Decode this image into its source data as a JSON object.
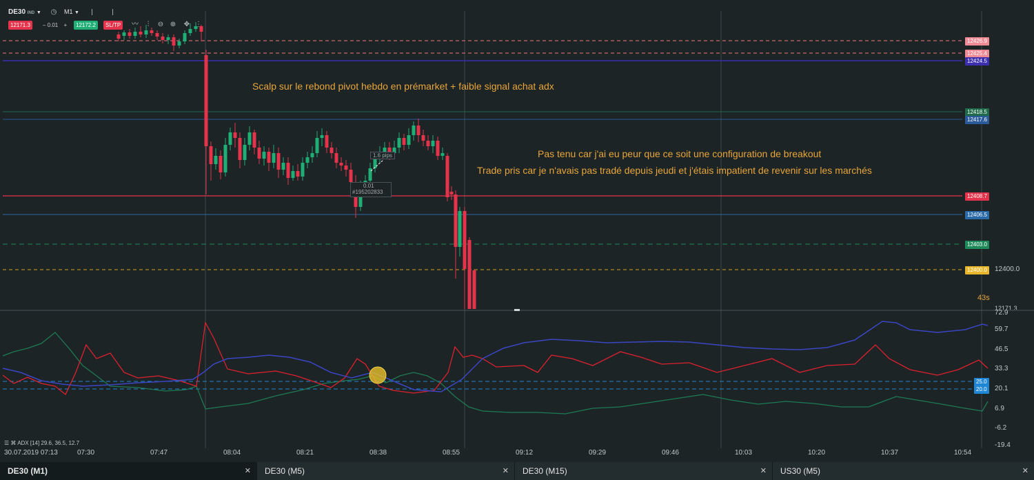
{
  "toolbar": {
    "symbol": "DE30",
    "symbol_sub": "IND",
    "timeframe": "M1",
    "sell_price": "12171.3",
    "quantity": "0.01",
    "buy_price": "12172.2",
    "sltp_label": "SL/TP"
  },
  "price_tags": {
    "p1": "12426.9",
    "p2": "12425.4",
    "p3": "12424.5",
    "p4": "12418.5",
    "p5": "12417.6",
    "p6": "12408.7",
    "p7": "12406.5",
    "p8": "12403.0",
    "p9": "12400.0",
    "axis_price": "12400.0",
    "current_price": "12171.3"
  },
  "annotations": {
    "note1": "Scalp sur le rebond pivot hebdo en prémarket + faible signal achat adx",
    "note2": "Pas tenu car j'ai eu peur que ce soit une configuration de breakout",
    "note3": "Trade pris car je n'avais pas tradé depuis jeudi et j'étais impatient de revenir sur les marchés",
    "pips_label": "1.6 pips",
    "order_qty": "0.01",
    "order_id": "#195202833",
    "countdown": "43s"
  },
  "indicator": {
    "label": "ADX [14] 29.6, 36.5, 12.7",
    "axis": [
      "72.9",
      "59.7",
      "46.5",
      "33.3",
      "20.1",
      "6.9",
      "-6.2",
      "-19.4"
    ],
    "level_25": "25.0",
    "level_20": "20.0"
  },
  "time_axis": {
    "start": "30.07.2019 07:13",
    "labels": [
      "07:30",
      "07:47",
      "08:04",
      "08:21",
      "08:38",
      "08:55",
      "09:12",
      "09:29",
      "09:46",
      "10:03",
      "10:20",
      "10:37",
      "10:54"
    ]
  },
  "tabs": [
    {
      "label": "DE30 (M1)",
      "active": true
    },
    {
      "label": "DE30 (M5)",
      "active": false
    },
    {
      "label": "DE30 (M15)",
      "active": false
    },
    {
      "label": "US30 (M5)",
      "active": false
    }
  ],
  "colors": {
    "background": "#1c2426",
    "bull": "#1fae75",
    "bear": "#e5334b",
    "adx_line": "#3b46c4",
    "di_plus": "#1e7a55",
    "di_minus": "#e0202e",
    "annotation": "#e8a53a"
  }
}
